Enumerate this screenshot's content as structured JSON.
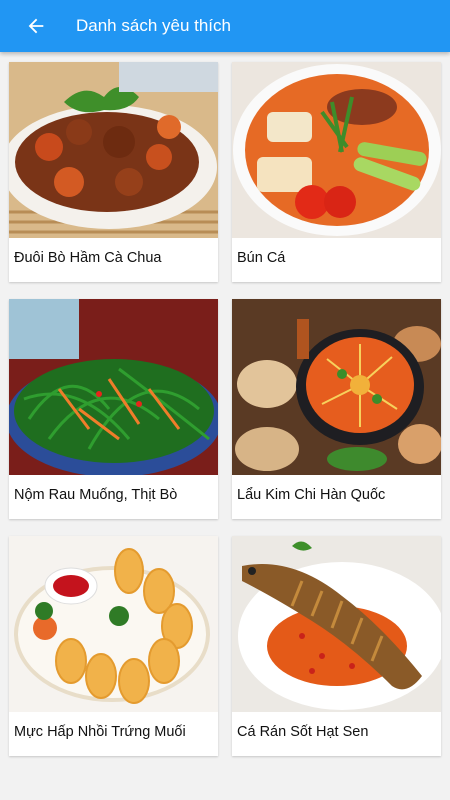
{
  "appbar": {
    "title": "Danh sách yêu thích",
    "back_icon": "arrow-left-icon",
    "color": "#2196f3"
  },
  "favorites": [
    {
      "name": "Đuôi Bò Hầm Cà Chua"
    },
    {
      "name": "Bún Cá"
    },
    {
      "name": "Nộm Rau Muống, Thịt Bò"
    },
    {
      "name": "Lẩu Kim Chi Hàn Quốc"
    },
    {
      "name": "Mực Hấp Nhồi Trứng Muối"
    },
    {
      "name": "Cá Rán Sốt Hạt Sen"
    }
  ]
}
